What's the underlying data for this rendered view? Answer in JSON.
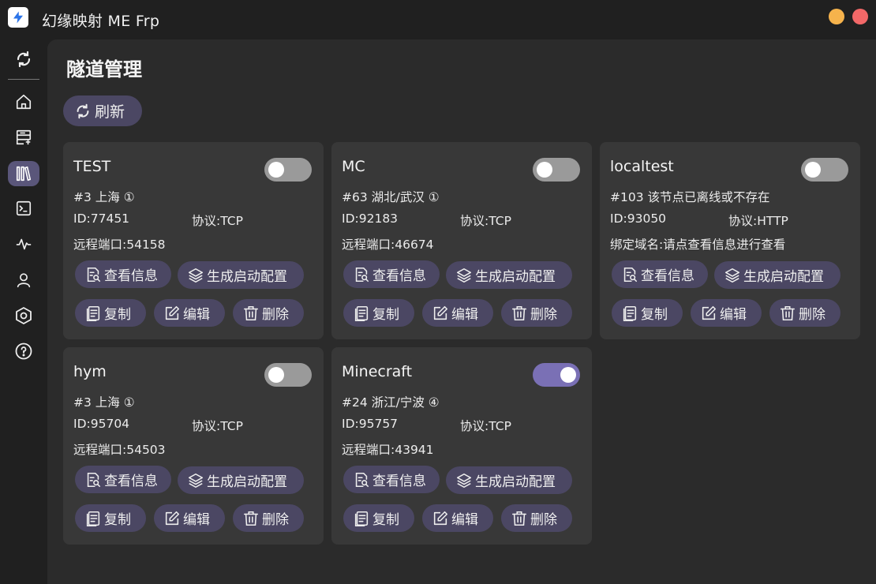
{
  "window": {
    "title": "幻缘映射 ME Frp"
  },
  "sidebar": {
    "items": [
      {
        "name": "refresh-icon"
      },
      {
        "name": "home-icon"
      },
      {
        "name": "add-tunnel-icon"
      },
      {
        "name": "tunnels-icon",
        "active": true
      },
      {
        "name": "terminal-icon"
      },
      {
        "name": "activity-icon"
      },
      {
        "name": "user-icon"
      },
      {
        "name": "settings-icon"
      },
      {
        "name": "help-icon"
      }
    ]
  },
  "page": {
    "title": "隧道管理",
    "refresh_label": "刷新"
  },
  "colors": {
    "accent": "#7a70b5",
    "button_bg": "#4b4763",
    "card_bg": "#383838",
    "panel_bg": "#2b2b2b",
    "window_bg": "#202020",
    "minimize": "#f6b34c",
    "close": "#f26868"
  },
  "buttons": {
    "info": "查看信息",
    "config": "生成启动配置",
    "copy": "复制",
    "edit": "编辑",
    "delete": "删除"
  },
  "tunnels": [
    {
      "name": "TEST",
      "node": "#3 上海 ①",
      "id": "ID:77451",
      "protocol": "协议:TCP",
      "extra": "远程端口:54158",
      "enabled": false
    },
    {
      "name": "MC",
      "node": "#63 湖北/武汉 ①",
      "id": "ID:92183",
      "protocol": "协议:TCP",
      "extra": "远程端口:46674",
      "enabled": false
    },
    {
      "name": "localtest",
      "node": "#103 该节点已离线或不存在",
      "id": "ID:93050",
      "protocol": "协议:HTTP",
      "extra": "绑定域名:请点查看信息进行查看",
      "enabled": false
    },
    {
      "name": "hym",
      "node": "#3 上海 ①",
      "id": "ID:95704",
      "protocol": "协议:TCP",
      "extra": "远程端口:54503",
      "enabled": false
    },
    {
      "name": "Minecraft",
      "node": "#24 浙江/宁波 ④",
      "id": "ID:95757",
      "protocol": "协议:TCP",
      "extra": "远程端口:43941",
      "enabled": true
    }
  ]
}
